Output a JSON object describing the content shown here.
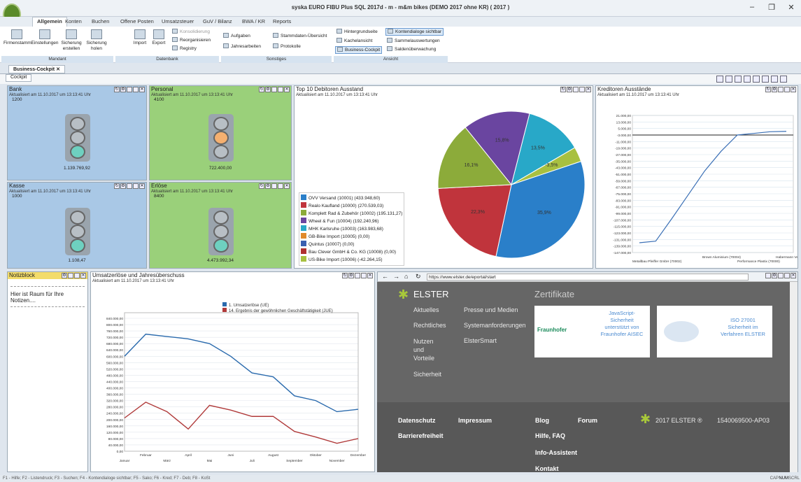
{
  "window": {
    "title": "syska EURO FIBU Plus SQL 2017d - m - m&m bikes (DEMO 2017 ohne KR) ( 2017 )",
    "controls": [
      "–",
      "❐",
      "✕"
    ]
  },
  "menu": {
    "tabs": [
      "Allgemein",
      "Konten",
      "Buchen",
      "Offene Posten",
      "Umsatzsteuer",
      "GuV / Bilanz",
      "BWA / KR",
      "Reports"
    ]
  },
  "ribbon": {
    "mandant": {
      "label": "Mandant",
      "buttons": [
        "Firmenstamm",
        "Einstellungen",
        "Sicherung erstellen",
        "Sicherung holen"
      ]
    },
    "datenbank": {
      "label": "Datenbank",
      "buttons": [
        "Import",
        "Export"
      ],
      "small": [
        "Konsolidierung",
        "Reorganisieren",
        "Registry"
      ]
    },
    "sonstiges": {
      "label": "Sonstiges",
      "small": [
        "Aufgaben",
        "Jahresarbeiten",
        "Stammdaten-Übersicht",
        "Protokolle"
      ]
    },
    "ansicht": {
      "label": "Ansicht",
      "small": [
        "Hintergrundseite",
        "Kachelansicht",
        "Business-Cockpit",
        "Kontendialoge sichtbar",
        "Sammelauswertungen",
        "Saldenüberwachung"
      ]
    }
  },
  "doc_tab": "Business-Cockpit",
  "cockpit_tab": "Cockpit",
  "panels": {
    "bank": {
      "title": "Bank",
      "updated": "Aktualisiert am 11.10.2017 um 13:13:41 Uhr",
      "account": "1200",
      "amount": "1.139.769,92"
    },
    "personal": {
      "title": "Personal",
      "updated": "Aktualisiert am 11.10.2017 um 13:13:41 Uhr",
      "account": "4100",
      "amount": "722.400,00"
    },
    "kasse": {
      "title": "Kasse",
      "updated": "Aktualisiert am 11.10.2017 um 13:13:41 Uhr",
      "account": "1000",
      "amount": "1.108,47"
    },
    "erloese": {
      "title": "Erlöse",
      "updated": "Aktualisiert am 11.10.2017 um 13:13:41 Uhr",
      "account": "8400",
      "amount": "4.473.992,34"
    },
    "debitoren": {
      "title": "Top 10 Debitoren Ausstand",
      "updated": "Aktualisiert am 11.10.2017 um 13:13:41 Uhr"
    },
    "kreditoren": {
      "title": "Kreditoren Ausstände",
      "updated": "Aktualisiert am 11.10.2017 um 13:13:41 Uhr"
    },
    "notiz": {
      "title": "Notizblock",
      "text": "Hier ist Raum für Ihre Notizen...."
    },
    "umsatz": {
      "title": "Umsatzerlöse und Jahresüberschuss",
      "updated": "Aktualisiert am 11.10.2017 um 13:13:41 Uhr"
    }
  },
  "chart_data": [
    {
      "type": "pie",
      "legend": [
        {
          "label": "OVV Versand (10001) (433.948,60)",
          "color": "#2a7fc9"
        },
        {
          "label": "Realo Kaufland (10000) (270.539,03)",
          "color": "#c0343c"
        },
        {
          "label": "Komplett Rad & Zubehör (10002) (195.131,27)",
          "color": "#8cab3a"
        },
        {
          "label": "Wheel & Fun (10004) (192.240,96)",
          "color": "#6a45a0"
        },
        {
          "label": "MHK Karlsruhe (10003) (163.983,68)",
          "color": "#28a8c8"
        },
        {
          "label": "GB-Bike Import (10005) (0,00)",
          "color": "#e08a2c"
        },
        {
          "label": "Quintus (10007) (0,00)",
          "color": "#3a5fb0"
        },
        {
          "label": "Bau Clever GmbH & Co. KG (10008) (0,00)",
          "color": "#b03030"
        },
        {
          "label": "US-Bike Import (10006) (-42.264,15)",
          "color": "#a8c040"
        }
      ],
      "slices": [
        {
          "value": 35.9,
          "label": "35,9%",
          "color": "#2a7fc9"
        },
        {
          "value": 22.3,
          "label": "22,3%",
          "color": "#c0343c"
        },
        {
          "value": 16.1,
          "label": "16,1%",
          "color": "#8cab3a"
        },
        {
          "value": 15.8,
          "label": "15,8%",
          "color": "#6a45a0"
        },
        {
          "value": 13.5,
          "label": "13,5%",
          "color": "#28a8c8"
        },
        {
          "value": 3.5,
          "label": "-3,5%",
          "color": "#a8c040"
        }
      ]
    },
    {
      "type": "line",
      "yticks": [
        "21.000,00",
        "13.000,00",
        "5.000,00",
        "-3.000,00",
        "-11.000,00",
        "-19.000,00",
        "-27.000,00",
        "-35.000,00",
        "-43.000,00",
        "-51.000,00",
        "-59.000,00",
        "-67.000,00",
        "-75.000,00",
        "-83.000,00",
        "-91.000,00",
        "-99.000,00",
        "-107.000,00",
        "-115.000,00",
        "-123.000,00",
        "-131.000,00",
        "-139.000,00",
        "-147.000,00"
      ],
      "xlabels": [
        "Metallbau Pfeiffer GmbH (70002)",
        "Brown Aluminium (70004)",
        "Performance Plastix (70000)",
        "Habermann Versand (70003)",
        "Van de Skorp (70001)"
      ],
      "ylim": [
        -147000,
        21000
      ],
      "values": [
        -135000,
        -133000,
        -105000,
        -76000,
        -47000,
        -23000,
        -3000,
        -1000,
        1000,
        1500
      ]
    },
    {
      "type": "line",
      "categories": [
        "Januar",
        "Februar",
        "März",
        "April",
        "Mai",
        "Juni",
        "Juli",
        "August",
        "September",
        "Oktober",
        "November",
        "Dezember"
      ],
      "yticks": [
        "840.000,00",
        "800.000,00",
        "760.000,00",
        "720.000,00",
        "680.000,00",
        "640.000,00",
        "600.000,00",
        "560.000,00",
        "520.000,00",
        "480.000,00",
        "440.000,00",
        "400.000,00",
        "360.000,00",
        "320.000,00",
        "280.000,00",
        "240.000,00",
        "200.000,00",
        "160.000,00",
        "120.000,00",
        "80.000,00",
        "40.000,00",
        "0,00"
      ],
      "ylim": [
        0,
        840000
      ],
      "series": [
        {
          "name": "1. Umsatzerlöse (UE)",
          "color": "#2a6aad",
          "values": [
            600000,
            740000,
            725000,
            710000,
            680000,
            600000,
            495000,
            470000,
            350000,
            320000,
            250000,
            265000
          ]
        },
        {
          "name": "14. Ergebnis der gewöhnlichen Geschäftstätigkeit (JUE)",
          "color": "#b03a3a",
          "values": [
            210000,
            310000,
            250000,
            140000,
            290000,
            260000,
            220000,
            220000,
            125000,
            90000,
            50000,
            80000
          ]
        }
      ]
    }
  ],
  "browser": {
    "url": "https://www.elster.de/eportal/start"
  },
  "elster": {
    "logo": "ELSTER",
    "zert": "Zertifikate",
    "nav": [
      "Aktuelles",
      "Rechtliches",
      "Nutzen und Vorteile",
      "Sicherheit",
      "Presse und Medien",
      "Systemanforderungen",
      "ElsterSmart"
    ],
    "cert1": "JavaScript-Sicherheit unterstützt von Fraunhofer AISEC",
    "cert1_logo": "Fraunhofer",
    "cert2": "ISO 27001 Sicherheit im Verfahren ELSTER",
    "footer": [
      "Datenschutz",
      "Impressum",
      "Blog",
      "Forum",
      "Barrierefreiheit",
      "Hilfe, FAQ",
      "Info-Assistent",
      "Kontakt"
    ],
    "copyright": "2017 ELSTER ®",
    "build": "1540069500-AP03"
  },
  "status": {
    "help": "F1 - Hilfe; F2 - Listendruck; F3 - Suchen; F4 - Kontendialoge sichtbar; F5 - Sako; F6 - Kred; F7 - Deb; F8 - KoSt",
    "caps": "CAP",
    "num": "NUM",
    "scrl": "SCRL"
  }
}
